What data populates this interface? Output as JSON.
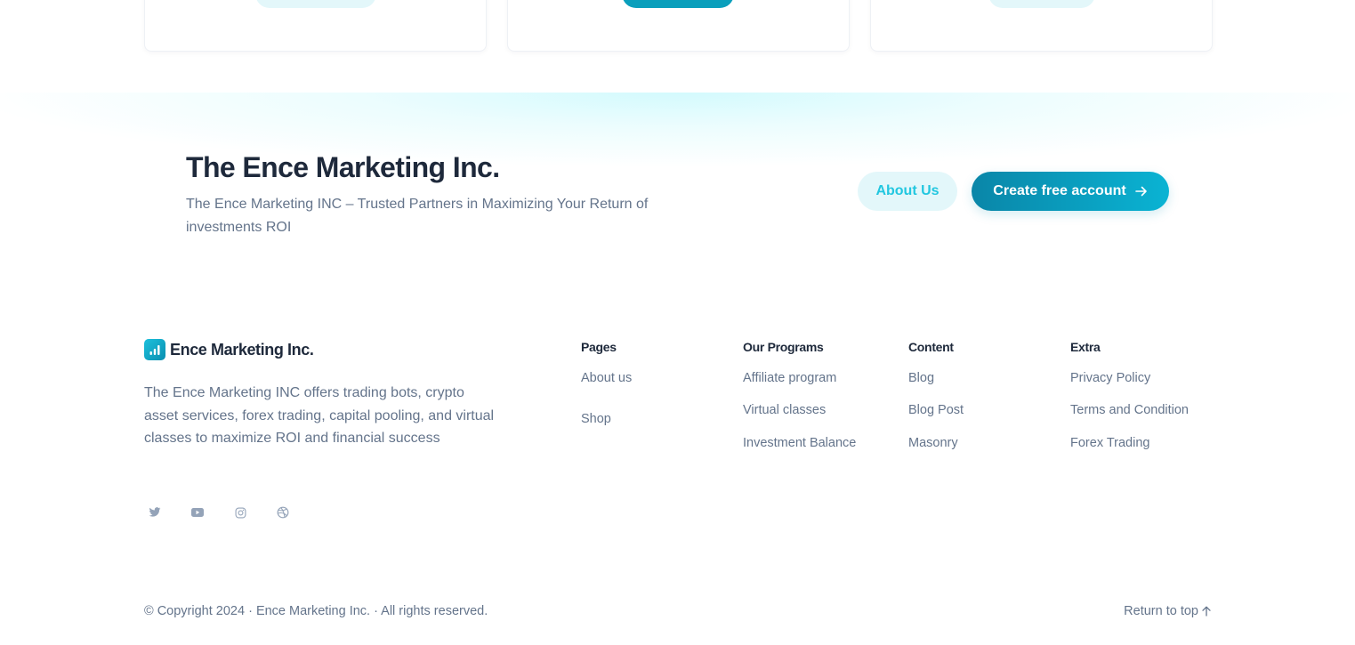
{
  "cta": {
    "title": "The Ence Marketing Inc.",
    "description": "The Ence Marketing INC – Trusted Partners in Maximizing Your Return of investments ROI",
    "about_button": "About Us",
    "create_button": "Create free account"
  },
  "footer": {
    "brand_name": "Ence Marketing Inc.",
    "brand_description": "The Ence Marketing INC offers trading bots, crypto asset services, forex trading, capital pooling, and virtual classes to maximize ROI and financial success",
    "social_icons": [
      "twitter-icon",
      "youtube-icon",
      "instagram-icon",
      "dribbble-icon"
    ],
    "columns": [
      {
        "heading": "Pages",
        "links": [
          "About us",
          "Shop"
        ]
      },
      {
        "heading": "Our Programs",
        "links": [
          "Affiliate program",
          "Virtual classes",
          "Investment Balance"
        ]
      },
      {
        "heading": "Content",
        "links": [
          "Blog",
          "Blog Post",
          "Masonry"
        ]
      },
      {
        "heading": "Extra",
        "links": [
          "Privacy Policy",
          "Terms and Condition",
          "Forex Trading"
        ]
      }
    ],
    "copyright": "© Copyright 2024 · Ence Marketing Inc. · All rights reserved.",
    "return_to_top": "Return to top"
  },
  "colors": {
    "accent": "#0ab3d3",
    "accent_dark": "#0a86a8",
    "accent_light_bg": "#e3f7fa",
    "heading": "#1e293b",
    "muted_text": "#64748b",
    "icon_gray": "#94a3b8"
  }
}
